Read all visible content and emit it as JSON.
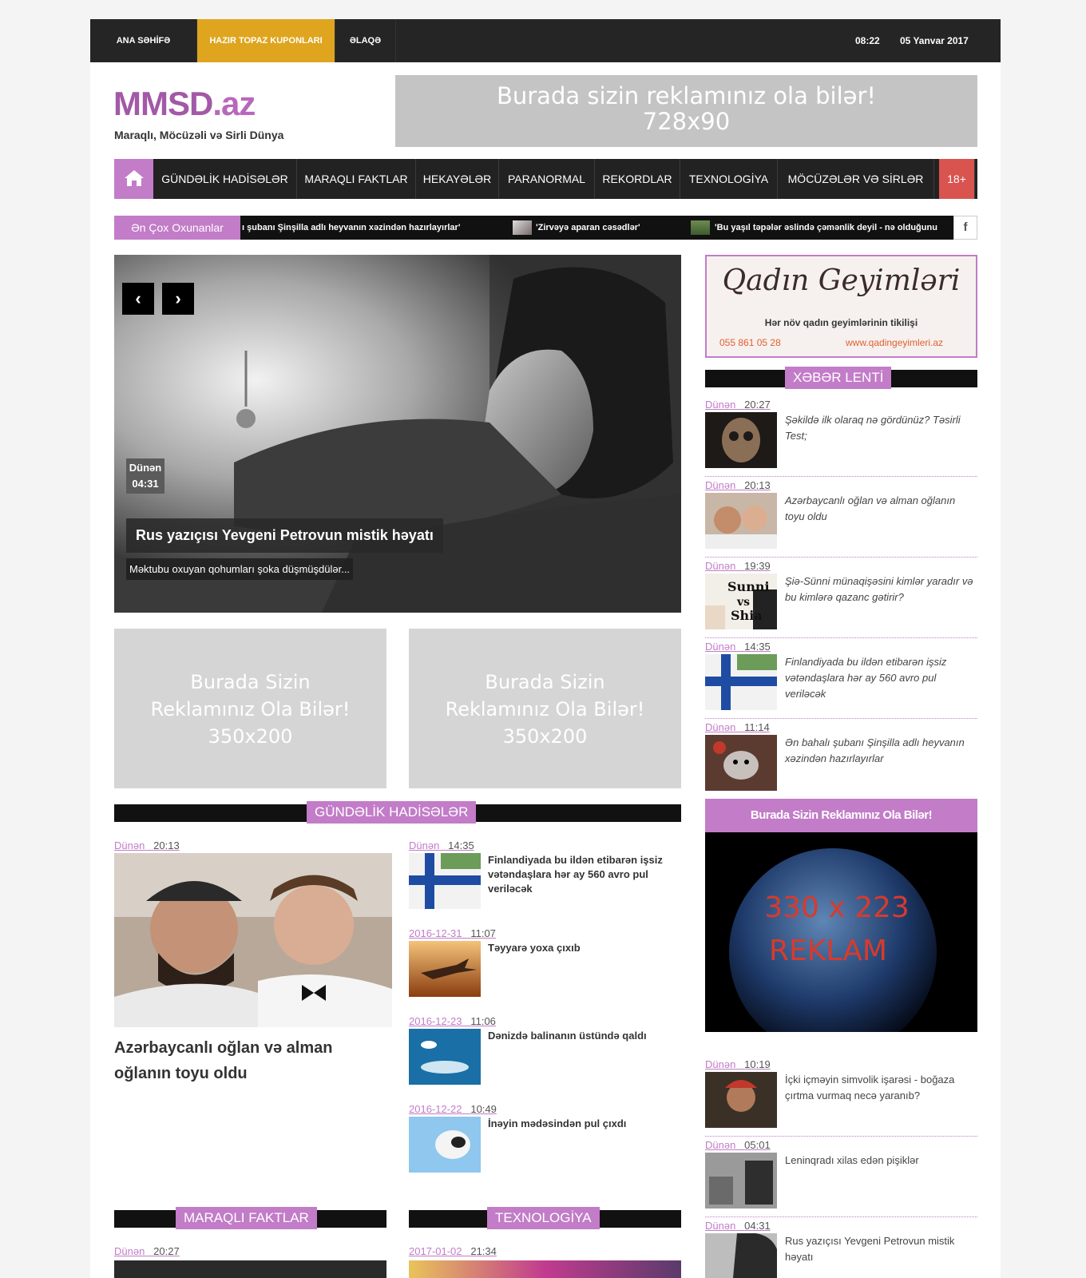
{
  "topbar": {
    "home": "ANA SƏHİFƏ",
    "coupons": "HAZIR TOPAZ KUPONLARI",
    "contact": "ƏLAQƏ",
    "time": "08:22",
    "date": "05 Yanvar 2017"
  },
  "logo": {
    "main": "MMSD",
    "tld": ".az",
    "tagline": "Maraqlı, Möcüzəli və Sirli Dünya"
  },
  "ad_top": {
    "line1": "Burada sizin reklamınız ola bilər!",
    "line2": "728x90"
  },
  "catnav": [
    "GÜNDƏLİK HADİSƏLƏR",
    "MARAQLI FAKTLAR",
    "HEKAYƏLƏR",
    "PARANORMAL",
    "REKORDLAR",
    "TEXNOLOGİYA",
    "MÖCÜZƏLƏR VƏ SİRLƏR",
    "18+"
  ],
  "ticker": {
    "label": "Ən Çox Oxunanlar",
    "items": [
      "ı şubanı Şinşilla adlı heyvanın xəzindən hazırlayırlar'",
      "'Zirvəyə aparan cəsədlər'",
      "'Bu yaşıl təpələr əslində çəmənlik deyil - nə olduğunu"
    ],
    "fb": "f"
  },
  "slider": {
    "date_day": "Dünən",
    "date_time": "04:31",
    "title": "Rus yazıçısı Yevgeni Petrovun mistik həyatı",
    "excerpt": "Məktubu oxuyan qohumları şoka düşmüşdülər...",
    "prev": "‹",
    "next": "›"
  },
  "ad_mid": {
    "line1": "Burada Sizin",
    "line2": "Reklamınız Ola Bilər!",
    "line3": "350x200"
  },
  "section_gundelik": {
    "title": "GÜNDƏLİK HADİSƏLƏR",
    "featured": {
      "day": "Dünən",
      "time": "20:13",
      "title": "Azərbaycanlı oğlan və alman oğlanın toyu oldu"
    },
    "items": [
      {
        "day": "Dünən",
        "time": "14:35",
        "title": "Finlandiyada bu ildən etibarən işsiz vətəndaşlara hər ay 560 avro pul veriləcək"
      },
      {
        "day": "2016-12-31",
        "time": "11:07",
        "title": "Təyyarə yoxa çıxıb"
      },
      {
        "day": "2016-12-23",
        "time": "11:06",
        "title": "Dənizdə balinanın üstündə qaldı"
      },
      {
        "day": "2016-12-22",
        "time": "10:49",
        "title": "İnəyin mədəsindən pul çıxdı"
      }
    ]
  },
  "section_faktlar": {
    "title": "MARAQLI FAKTLAR",
    "day": "Dünən",
    "time": "20:27"
  },
  "section_texno": {
    "title": "TEXNOLOGİYA",
    "day": "2017-01-02",
    "time": "21:34"
  },
  "ad_qadin": {
    "title": "Qadın Geyimləri",
    "subtitle": "Hər növ qadın geyimlərinin tikilişi",
    "phone": "055 861 05 28",
    "site": "www.qadingeyimleri.az"
  },
  "news_feed": {
    "title": "XƏBƏR LENTİ",
    "items": [
      {
        "day": "Dünən",
        "time": "20:27",
        "title": "Şəkildə ilk olaraq nə gördünüz? Təsirli Test;"
      },
      {
        "day": "Dünən",
        "time": "20:13",
        "title": "Azərbaycanlı oğlan və alman oğlanın toyu oldu"
      },
      {
        "day": "Dünən",
        "time": "19:39",
        "title": "Şiə-Sünni münaqişəsini kimlər yaradır və bu kimlərə qazanc gətirir?"
      },
      {
        "day": "Dünən",
        "time": "14:35",
        "title": "Finlandiyada bu ildən etibarən işsiz vətəndaşlara hər ay 560 avro pul veriləcək"
      },
      {
        "day": "Dünən",
        "time": "11:14",
        "title": "Ən bahalı şubanı Şinşilla adlı heyvanın xəzindən hazırlayırlar"
      }
    ],
    "thumb3_text1": "Sunni",
    "thumb3_text2": "vs",
    "thumb3_text3": "Shia"
  },
  "ad_right": {
    "bar": "Burada Sizin Reklamınız Ola Bilər!",
    "size": "330 x 223",
    "word": "REKLAM"
  },
  "news_feed2": [
    {
      "day": "Dünən",
      "time": "10:19",
      "title": "İçki içməyin simvolik işarəsi - boğaza çırtma vurmaq necə yaranıb?"
    },
    {
      "day": "Dünən",
      "time": "05:01",
      "title": "Leninqradı xilas edən pişiklər"
    },
    {
      "day": "Dünən",
      "time": "04:31",
      "title": "Rus yazıçısı Yevgeni Petrovun mistik həyatı"
    }
  ]
}
